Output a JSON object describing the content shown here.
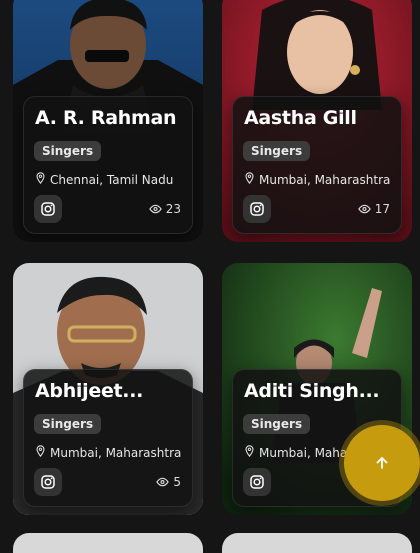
{
  "cards": [
    {
      "name": "A. R. Rahman",
      "category": "Singers",
      "location": "Chennai, Tamil Nadu",
      "views": "23"
    },
    {
      "name": "Aastha Gill",
      "category": "Singers",
      "location": "Mumbai, Maharashtra",
      "views": "17"
    },
    {
      "name": "Abhijeet...",
      "category": "Singers",
      "location": "Mumbai, Maharashtra",
      "views": "5"
    },
    {
      "name": "Aditi Singh...",
      "category": "Singers",
      "location": "Mumbai, Maharashtra",
      "views": ""
    }
  ],
  "icons": {
    "location": "location-pin-icon",
    "instagram": "instagram-icon",
    "views": "eye-icon",
    "scroll_top": "arrow-up-icon"
  },
  "colors": {
    "accent": "#c69b0e",
    "background": "#151515"
  }
}
